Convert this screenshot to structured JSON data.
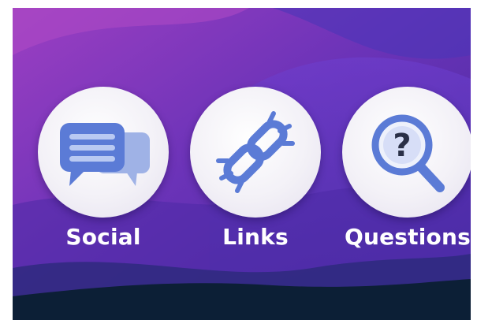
{
  "tiles": [
    {
      "label": "Social",
      "icon": "chat-bubbles-icon"
    },
    {
      "label": "Links",
      "icon": "broken-chain-link-icon"
    },
    {
      "label": "Questions",
      "icon": "magnifier-question-icon"
    }
  ],
  "colors": {
    "background_top": "#7d3ac4",
    "background_mid": "#5a2fb0",
    "wave_dark": "#0c1f36",
    "icon_blue": "#5b7bd6",
    "label_text": "#ffffff"
  }
}
